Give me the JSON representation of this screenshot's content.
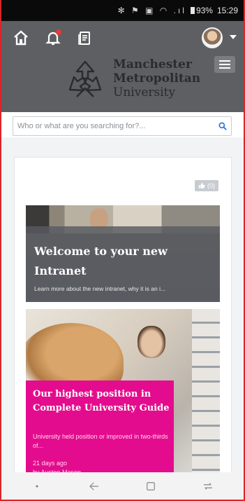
{
  "status_bar": {
    "indicators": "✻ ⚑ ▣ ◠ .ıl",
    "battery": "93%",
    "time": "15:29"
  },
  "toolbar": {
    "icons": [
      "home-icon",
      "notification-bell-icon",
      "documents-icon"
    ],
    "has_notification": true
  },
  "brand": {
    "line1": "Manchester",
    "line2": "Metropolitan",
    "line3": "University"
  },
  "search": {
    "placeholder": "Who or what are you searching for?..."
  },
  "like_badge": {
    "count": "(0)"
  },
  "news": [
    {
      "title": "Welcome to your new Intranet",
      "excerpt": "Learn more about the new intranet, why it is an i..."
    },
    {
      "title": "Our highest position in Complete University Guide",
      "excerpt": "University held position or improved in two-thirds of...",
      "date": "21 days ago",
      "author": "by Austen Mason"
    }
  ],
  "colors": {
    "toolbar": "#5d5f63",
    "accent_magenta": "#e40c8e",
    "search_icon": "#2a7bd6"
  }
}
